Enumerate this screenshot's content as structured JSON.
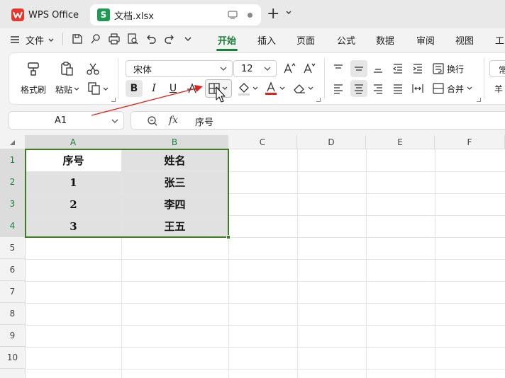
{
  "tabs": {
    "app_tab_label": "WPS Office",
    "doc_tab_label": "文档.xlsx"
  },
  "menubar": {
    "file_label": "文件",
    "items": [
      "开始",
      "插入",
      "页面",
      "公式",
      "数据",
      "审阅",
      "视图",
      "工"
    ],
    "active": "开始"
  },
  "ribbon": {
    "format_painter_label": "格式刷",
    "paste_label": "粘贴",
    "font_name": "宋体",
    "font_size": "12",
    "wrap_text_label": "换行",
    "merge_label": "合并",
    "cut_off_right_1": "常",
    "cut_off_right_2": "羊",
    "bold_label": "B",
    "italic_label": "I",
    "underline_label": "U"
  },
  "formula_bar": {
    "name_box_value": "A1",
    "fx_label": "fx",
    "formula_content": "序号"
  },
  "grid": {
    "columns": [
      "A",
      "B",
      "C",
      "D",
      "E",
      "F"
    ],
    "rows": [
      "1",
      "2",
      "3",
      "4",
      "5",
      "6",
      "7",
      "8",
      "9",
      "10"
    ],
    "cells": [
      [
        "序号",
        "姓名"
      ],
      [
        "1",
        "张三"
      ],
      [
        "2",
        "李四"
      ],
      [
        "3",
        "王五"
      ]
    ]
  },
  "colors": {
    "accent": "#1a7f3c",
    "selection_border": "#3c7d22",
    "annotation_arrow": "#e0221c",
    "font_color_bar": "#e0221c"
  }
}
